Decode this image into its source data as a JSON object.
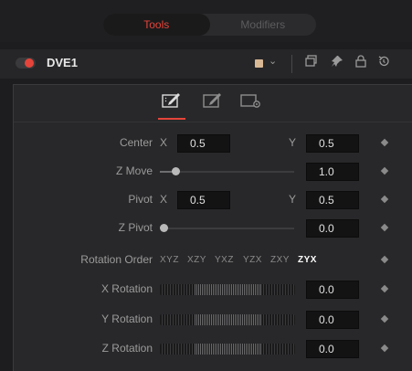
{
  "tabs": {
    "tools_label": "Tools",
    "modifiers_label": "Modifiers"
  },
  "node": {
    "name": "DVE1",
    "enabled": true,
    "swatch_color": "#d9b896",
    "icons": [
      "color-swatch-icon",
      "chevron-down-icon",
      "copy-icon",
      "pin-icon",
      "lock-icon",
      "reset-icon"
    ]
  },
  "subtabs": [
    "controls-tab-icon",
    "edit-tab-icon",
    "settings-tab-icon"
  ],
  "controls": {
    "center": {
      "label": "Center",
      "x_label": "X",
      "x": "0.5",
      "y_label": "Y",
      "y": "0.5"
    },
    "z_move": {
      "label": "Z Move",
      "value": "1.0",
      "level": 0.1
    },
    "pivot": {
      "label": "Pivot",
      "x_label": "X",
      "x": "0.5",
      "y_label": "Y",
      "y": "0.5"
    },
    "z_pivot": {
      "label": "Z Pivot",
      "value": "0.0",
      "level": 0.0
    },
    "rotation_order": {
      "label": "Rotation Order",
      "options": [
        "XYZ",
        "XZY",
        "YXZ",
        "YZX",
        "ZXY",
        "ZYX"
      ],
      "selected": "ZYX"
    },
    "x_rotation": {
      "label": "X Rotation",
      "value": "0.0"
    },
    "y_rotation": {
      "label": "Y Rotation",
      "value": "0.0"
    },
    "z_rotation": {
      "label": "Z Rotation",
      "value": "0.0"
    }
  },
  "colors": {
    "accent": "#e5443a",
    "background": "#1d1d1f",
    "panel": "#28282a"
  }
}
